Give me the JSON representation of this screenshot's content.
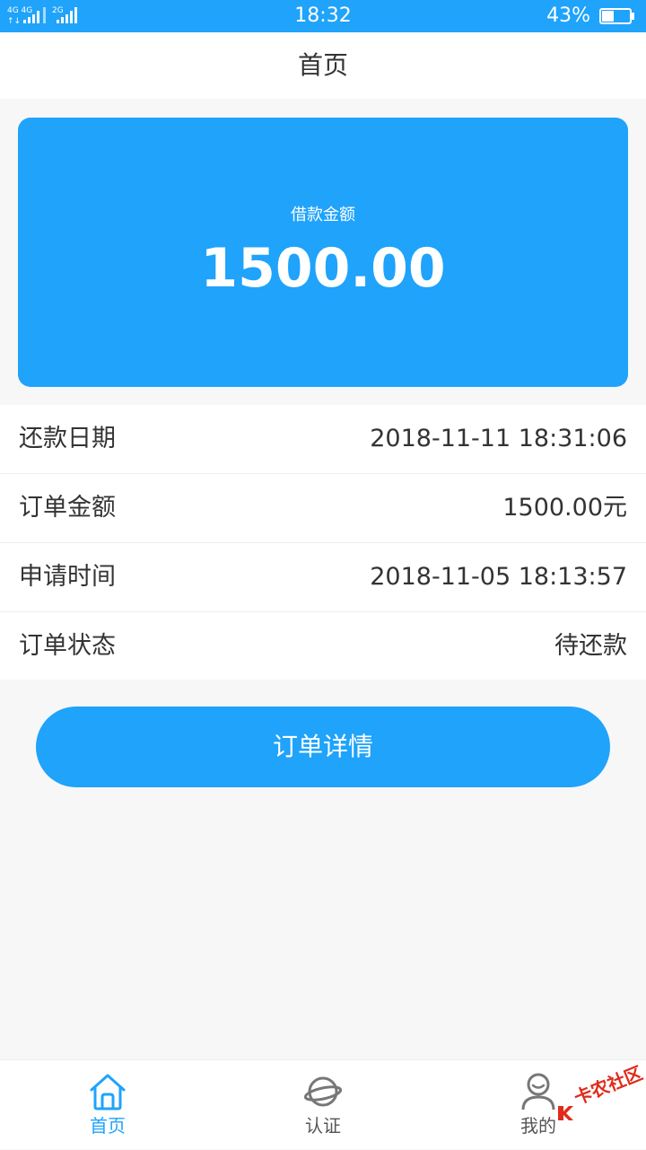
{
  "status_bar": {
    "network": "4G 4G 2G",
    "time": "18:32",
    "battery_percent": "43%",
    "battery_level": 0.43
  },
  "header": {
    "title": "首页"
  },
  "loan_card": {
    "label": "借款金额",
    "amount": "1500.00"
  },
  "details": [
    {
      "label": "还款日期",
      "value": "2018-11-11 18:31:06"
    },
    {
      "label": "订单金额",
      "value": "1500.00元"
    },
    {
      "label": "申请时间",
      "value": "2018-11-05 18:13:57"
    },
    {
      "label": "订单状态",
      "value": "待还款"
    }
  ],
  "detail_button": {
    "label": "订单详情"
  },
  "tabs": [
    {
      "label": "首页",
      "icon": "home-icon",
      "active": true
    },
    {
      "label": "认证",
      "icon": "planet-icon",
      "active": false
    },
    {
      "label": "我的",
      "icon": "user-icon",
      "active": false
    }
  ],
  "watermark": {
    "text": "卡农社区"
  },
  "colors": {
    "accent": "#1fa3fb",
    "background": "#f7f7f7",
    "text": "#333333",
    "watermark": "#e02b1b"
  }
}
